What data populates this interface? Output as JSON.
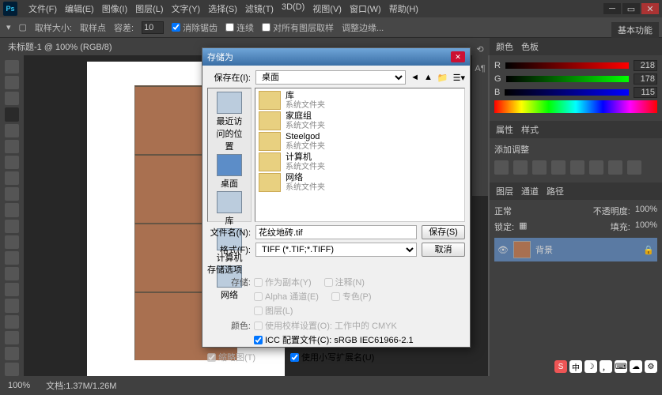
{
  "menu": {
    "file": "文件(F)",
    "edit": "编辑(E)",
    "image": "图像(I)",
    "layer": "图层(L)",
    "text": "文字(Y)",
    "select": "选择(S)",
    "filter": "滤镜(T)",
    "threed": "3D(D)",
    "view": "视图(V)",
    "window": "窗口(W)",
    "help": "帮助(H)"
  },
  "optbar": {
    "sample_label": "取样大小:",
    "sample_value": "取样点",
    "tol_label": "容差:",
    "tol_value": "10",
    "antialias": "消除锯齿",
    "contiguous": "连续",
    "all_layers": "对所有图层取样",
    "refine": "调整边缘..."
  },
  "tab": {
    "title": "未标题-1 @ 100% (RGB/8)"
  },
  "basic_fn": "基本功能",
  "color_panel": {
    "tab1": "颜色",
    "tab2": "色板",
    "r": "R",
    "g": "G",
    "b": "B",
    "r_val": "218",
    "g_val": "178",
    "b_val": "115"
  },
  "adjust_panel": {
    "tab1": "属性",
    "tab2": "样式",
    "title": "添加调整"
  },
  "layers_panel": {
    "tab1": "图层",
    "tab2": "通道",
    "tab3": "路径",
    "mode": "正常",
    "opacity_lbl": "不透明度:",
    "opacity": "100%",
    "lock_lbl": "锁定:",
    "fill_lbl": "填充:",
    "fill": "100%",
    "layer_name": "背景"
  },
  "status": {
    "zoom": "100%",
    "doc": "文档:1.37M/1.26M"
  },
  "dialog": {
    "title": "存储为",
    "savein_lbl": "保存在(I):",
    "savein_val": "桌面",
    "places": {
      "recent": "最近访问的位置",
      "desktop": "桌面",
      "libs": "库",
      "computer": "计算机",
      "network": "网络"
    },
    "files": [
      {
        "name": "库",
        "sub": "系统文件夹"
      },
      {
        "name": "家庭组",
        "sub": "系统文件夹"
      },
      {
        "name": "Steelgod",
        "sub": "系统文件夹"
      },
      {
        "name": "计算机",
        "sub": "系统文件夹"
      },
      {
        "name": "网络",
        "sub": "系统文件夹"
      }
    ],
    "filename_lbl": "文件名(N):",
    "filename_val": "花纹地砖.tif",
    "format_lbl": "格式(F):",
    "format_val": "TIFF (*.TIF;*.TIFF)",
    "save_btn": "保存(S)",
    "cancel_btn": "取消",
    "opts_hdr": "存储选项",
    "store_lbl": "存储:",
    "color_lbl": "颜色:",
    "as_copy": "作为副本(Y)",
    "notes": "注释(N)",
    "alpha": "Alpha 通道(E)",
    "spot": "专色(P)",
    "layers": "图层(L)",
    "proof": "使用校样设置(O): 工作中的 CMYK",
    "icc": "ICC 配置文件(C): sRGB IEC61966-2.1",
    "thumb": "缩略图(T)",
    "lower_ext": "使用小写扩展名(U)"
  },
  "right_tabs": {
    "hist": "历",
    "char": "A¶"
  }
}
